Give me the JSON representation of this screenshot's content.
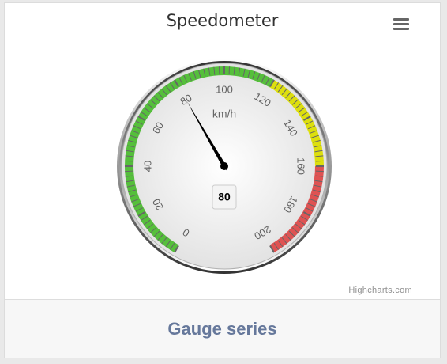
{
  "chart_data": {
    "type": "gauge",
    "title": "Speedometer",
    "unit_label": "km/h",
    "min": 0,
    "max": 200,
    "tick_labels": [
      "0",
      "20",
      "40",
      "60",
      "80",
      "100",
      "120",
      "140",
      "160",
      "180",
      "200"
    ],
    "value": 80,
    "data_label": "80",
    "bands": [
      {
        "from": 0,
        "to": 120,
        "color": "#55bf3b"
      },
      {
        "from": 120,
        "to": 160,
        "color": "#dddf0d"
      },
      {
        "from": 160,
        "to": 200,
        "color": "#df5353"
      }
    ],
    "credits": "Highcharts.com"
  },
  "footer": {
    "label": "Gauge series"
  },
  "icons": {
    "menu": "hamburger-menu-icon"
  }
}
